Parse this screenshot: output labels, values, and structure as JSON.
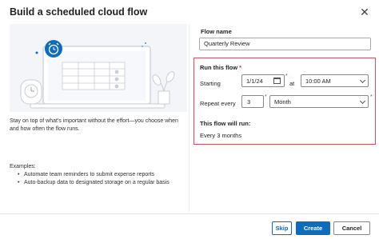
{
  "dialog": {
    "title": "Build a scheduled cloud flow",
    "close_icon": "close-icon"
  },
  "left": {
    "description": "Stay on top of what's important without the effort—you choose when and how often the flow runs.",
    "examples_label": "Examples:",
    "examples": [
      "Automate team reminders to submit expense reports",
      "Auto-backup data to designated storage on a regular basis"
    ]
  },
  "form": {
    "flow_name_label": "Flow name",
    "flow_name_value": "Quarterly Review",
    "run_label": "Run this flow",
    "required_marker": "*",
    "starting_label": "Starting",
    "start_date": "1/1/24",
    "at_label": "at",
    "start_time": "10:00 AM",
    "repeat_label": "Repeat every",
    "repeat_interval": "3",
    "repeat_unit": "Month",
    "will_run_label": "This flow will run:",
    "will_run_value": "Every 3 months"
  },
  "footer": {
    "skip_label": "Skip",
    "create_label": "Create",
    "cancel_label": "Cancel"
  },
  "colors": {
    "accent": "#0f6cbd",
    "highlight_border": "#d74f5a",
    "required": "#c4314b",
    "illustration_bg": "#f3f5f9"
  }
}
